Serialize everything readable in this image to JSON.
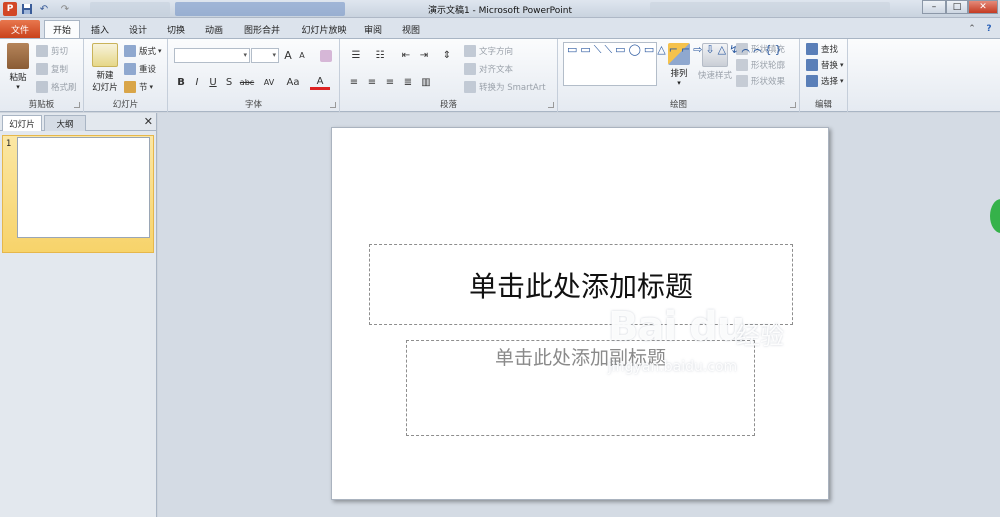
{
  "window": {
    "app_icon": "P",
    "title": "演示文稿1 - Microsoft PowerPoint",
    "minimize": "–",
    "maximize": "□",
    "close": "✕"
  },
  "qat": {
    "save_icon": "save-icon",
    "undo": "↶",
    "redo": "↷"
  },
  "tabs": [
    "文件",
    "开始",
    "插入",
    "设计",
    "切换",
    "动画",
    "图形合并",
    "幻灯片放映",
    "审阅",
    "视图"
  ],
  "ribbon": {
    "clipboard": {
      "label": "剪贴板",
      "paste": "粘贴",
      "cut": "剪切",
      "copy": "复制",
      "format_painter": "格式刷"
    },
    "slides": {
      "label": "幻灯片",
      "new_slide": "新建",
      "new_slide_2": "幻灯片",
      "layout": "版式",
      "reset": "重设",
      "section": "节"
    },
    "font": {
      "label": "字体",
      "bold": "B",
      "italic": "I",
      "underline": "U",
      "strike": "S",
      "shadow": "abc",
      "spacing": "AV",
      "case": "Aa",
      "color": "A",
      "grow": "A",
      "shrink": "A"
    },
    "paragraph": {
      "label": "段落",
      "text_direction": "文字方向",
      "align_text": "对齐文本",
      "smartart": "转换为 SmartArt"
    },
    "drawing": {
      "label": "绘图",
      "arrange": "排列",
      "quick_styles": "快速样式",
      "shape_fill": "形状填充",
      "shape_outline": "形状轮廓",
      "shape_effects": "形状效果",
      "shapes_glyphs": "▭▭⟍⟍▭◯▭△⌐⌐⇨⇩△↯⌒⌒{}"
    },
    "editing": {
      "label": "编辑",
      "find": "查找",
      "replace": "替换",
      "select": "选择"
    }
  },
  "left_pane": {
    "tab_slides": "幻灯片",
    "tab_outline": "大纲",
    "close": "✕",
    "slide_number": "1"
  },
  "slide": {
    "title_placeholder": "单击此处添加标题",
    "subtitle_placeholder": "单击此处添加副标题"
  },
  "watermark": {
    "logo": "Bai du",
    "cn": "经验",
    "url": "jingyan.baidu.com"
  },
  "colors": {
    "file_tab": "#d24726",
    "ribbon_bg": "#f4f6f9",
    "selected_thumb": "#f7d36a"
  }
}
